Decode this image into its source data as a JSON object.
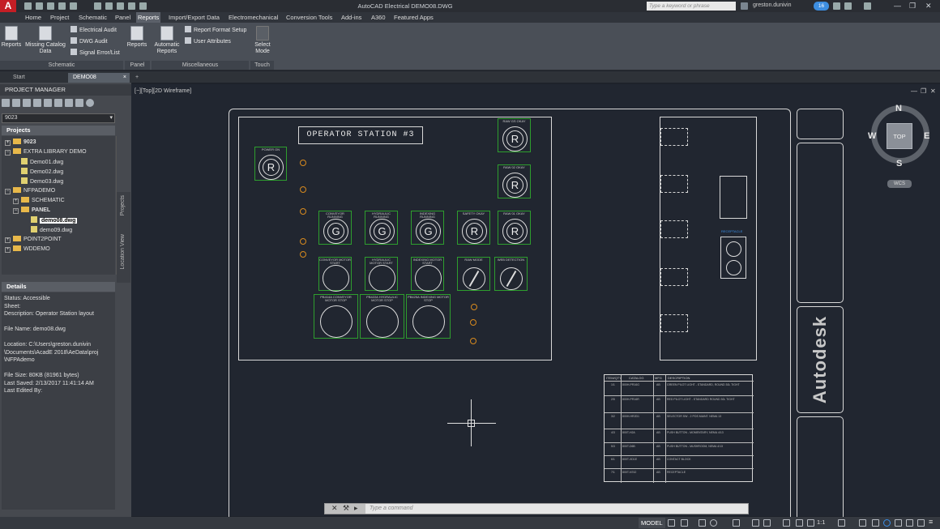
{
  "app": {
    "logo_letter": "A",
    "window_title": "AutoCAD Electrical   DEMO08.DWG",
    "search_placeholder": "Type a keyword or phrase",
    "user": "greston.dunivin",
    "notification_count": "16",
    "accent_color": "#c41e25"
  },
  "menu": {
    "tabs": [
      "Home",
      "Project",
      "Schematic",
      "Panel",
      "Reports",
      "Import/Export Data",
      "Electromechanical",
      "Conversion Tools",
      "Add-ins",
      "A360",
      "Featured Apps"
    ],
    "active": "Reports"
  },
  "ribbon": {
    "reports_label": "Reports",
    "missing_catalog_label": "Missing Catalog Data",
    "electrical_audit": "Electrical Audit",
    "dwg_audit": "DWG Audit",
    "signal_error_list": "Signal Error/List",
    "panel_reports_label": "Reports",
    "automatic_reports_label": "Automatic Reports",
    "report_format_setup": "Report Format Setup",
    "user_attributes": "User Attributes",
    "select_mode_label": "Select Mode",
    "groups": {
      "schematic": "Schematic",
      "panel": "Panel",
      "misc": "Miscellaneous",
      "touch": "Touch"
    }
  },
  "doc_tabs": {
    "start": "Start",
    "active": "DEMO08",
    "close": "×",
    "add": "+"
  },
  "project_manager": {
    "title": "PROJECT MANAGER",
    "selected_project": "9023",
    "projects_header": "Projects",
    "tree": [
      {
        "label": "9023",
        "level": 0,
        "type": "project",
        "bold": true
      },
      {
        "label": "EXTRA LIBRARY DEMO",
        "level": 0,
        "type": "project"
      },
      {
        "label": "Demo01.dwg",
        "level": 1,
        "type": "dwg"
      },
      {
        "label": "Demo02.dwg",
        "level": 1,
        "type": "dwg"
      },
      {
        "label": "Demo03.dwg",
        "level": 1,
        "type": "dwg"
      },
      {
        "label": "NFPADEMO",
        "level": 0,
        "type": "project"
      },
      {
        "label": "SCHEMATIC",
        "level": 1,
        "type": "folder"
      },
      {
        "label": "PANEL",
        "level": 1,
        "type": "folder",
        "bold": true
      },
      {
        "label": "demo08.dwg",
        "level": 2,
        "type": "dwg",
        "selected": true
      },
      {
        "label": "demo09.dwg",
        "level": 2,
        "type": "dwg"
      },
      {
        "label": "POINT2POINT",
        "level": 0,
        "type": "project"
      },
      {
        "label": "WDDEMO",
        "level": 0,
        "type": "project"
      }
    ],
    "side_tabs": [
      "Projects",
      "Location View"
    ],
    "details_header": "Details",
    "details_lines": [
      "Status: Accessible",
      "Sheet:",
      "Description: Operator Station layout",
      "",
      "File Name: demo08.dwg",
      "",
      "Location: C:\\Users\\greston.dunivin",
      "\\Documents\\AcadE 2018\\AeData\\proj",
      "\\NFPAdemo",
      "",
      "File Size: 80KB (81961 bytes)",
      "Last Saved: 2/13/2017 11:41:14 AM",
      "Last Edited By:"
    ]
  },
  "viewport": {
    "label": "[−][Top][2D Wireframe]",
    "station_title": "OPERATOR STATION #3",
    "lamps_top": [
      {
        "cap": "POWER ON",
        "letter": "R"
      },
      {
        "cap": "RAW GS OKAY",
        "letter": "R"
      },
      {
        "cap": "RAW 02 OKAY",
        "letter": "R"
      }
    ],
    "lamps_row": [
      {
        "cap": "CONVEYOR RUNNING",
        "letter": "G"
      },
      {
        "cap": "HYDRAULIC RUNNING",
        "letter": "G"
      },
      {
        "cap": "INDEXING RUNNING",
        "letter": "G"
      },
      {
        "cap": "SAFETY OKAY",
        "letter": "R"
      },
      {
        "cap": "RAW 01 OKAY",
        "letter": "R"
      }
    ],
    "switches_row": [
      {
        "cap": "CONVEYOR MOTOR START"
      },
      {
        "cap": "HYDRAULIC MOTOR START"
      },
      {
        "cap": "INDEXING MOTOR START"
      },
      {
        "cap": "RAW MODE"
      },
      {
        "cap": "WEB DETECTION"
      }
    ],
    "stop_buttons": [
      {
        "cap": "PB414A CONVEYOR MOTOR STOP"
      },
      {
        "cap": "PB422A HYDRAULIC MOTOR STOP"
      },
      {
        "cap": "PB425A INDEXING MOTOR STOP"
      }
    ],
    "receptacle_label": "RECEPTACLE",
    "logo_text": "Autodesk",
    "bom_headers": [
      "ITEM/QTY",
      "CATALOG",
      "MFG",
      "DESCRIPTION"
    ],
    "bom_rows": [
      [
        "1/1",
        "800H-PR16G",
        "AB",
        "GREEN PILOT LIGHT - STANDARD, ROUND 30L TIGHT"
      ],
      [
        "2/5",
        "800H-PR16R",
        "AB",
        "RED PILOT LIGHT - STANDARD ROUND 30L TIGHT"
      ],
      [
        "3/2",
        "800H-HR2D1",
        "AB",
        "SELECTOR SW - 2 POS MAINT. NEMA 13"
      ],
      [
        "4/3",
        "800T-H2A",
        "AB",
        "PUSH BUTTON - MOMENTARY, NEMA 4/13"
      ],
      [
        "5/3",
        "800T-D6B",
        "AB",
        "PUSH BUTTON - MUSHROOM, NEMA 4/13"
      ],
      [
        "6/1",
        "800T-XD1E",
        "AB",
        "CONTACT BLOCK"
      ],
      [
        "7/1",
        "800T-N742",
        "AB",
        "RECEPTACLE"
      ]
    ],
    "viewcube": {
      "n": "N",
      "s": "S",
      "e": "E",
      "w": "W",
      "face": "TOP",
      "wcs": "WCS"
    }
  },
  "command_line": {
    "placeholder": "Type a command"
  },
  "status_bar": {
    "model": "MODEL",
    "scale": "1:1"
  }
}
